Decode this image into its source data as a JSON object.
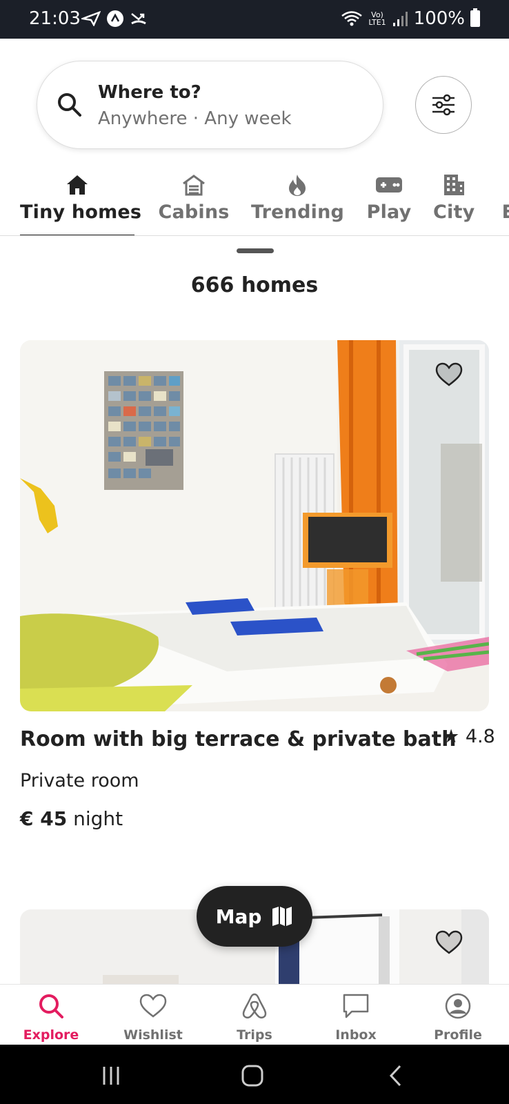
{
  "status_bar": {
    "time": "21:03",
    "network": "LTE1",
    "battery": "100%"
  },
  "search": {
    "title": "Where to?",
    "subtitle": "Anywhere · Any week"
  },
  "categories": [
    {
      "label": "Tiny homes",
      "icon": "house-icon",
      "active": true
    },
    {
      "label": "Cabins",
      "icon": "cabin-icon",
      "active": false
    },
    {
      "label": "Trending",
      "icon": "flame-icon",
      "active": false
    },
    {
      "label": "Play",
      "icon": "game-controller-icon",
      "active": false
    },
    {
      "label": "City",
      "icon": "city-building-icon",
      "active": false
    },
    {
      "label": "E",
      "icon": "",
      "active": false
    }
  ],
  "results": {
    "count_label": "666 homes"
  },
  "listing": {
    "title": "Room with big terrace & private bath",
    "rating": "4.8",
    "type": "Private room",
    "price": "€ 45",
    "price_unit": "night"
  },
  "map_button": {
    "label": "Map"
  },
  "bottom_nav": [
    {
      "label": "Explore",
      "icon": "search-icon",
      "active": true
    },
    {
      "label": "Wishlist",
      "icon": "heart-icon",
      "active": false
    },
    {
      "label": "Trips",
      "icon": "airbnb-logo-icon",
      "active": false
    },
    {
      "label": "Inbox",
      "icon": "message-icon",
      "active": false
    },
    {
      "label": "Profile",
      "icon": "profile-icon",
      "active": false
    }
  ],
  "colors": {
    "accent": "#e31c5f",
    "text": "#222222",
    "muted": "#717171",
    "status_bar": "#1b1f28"
  }
}
